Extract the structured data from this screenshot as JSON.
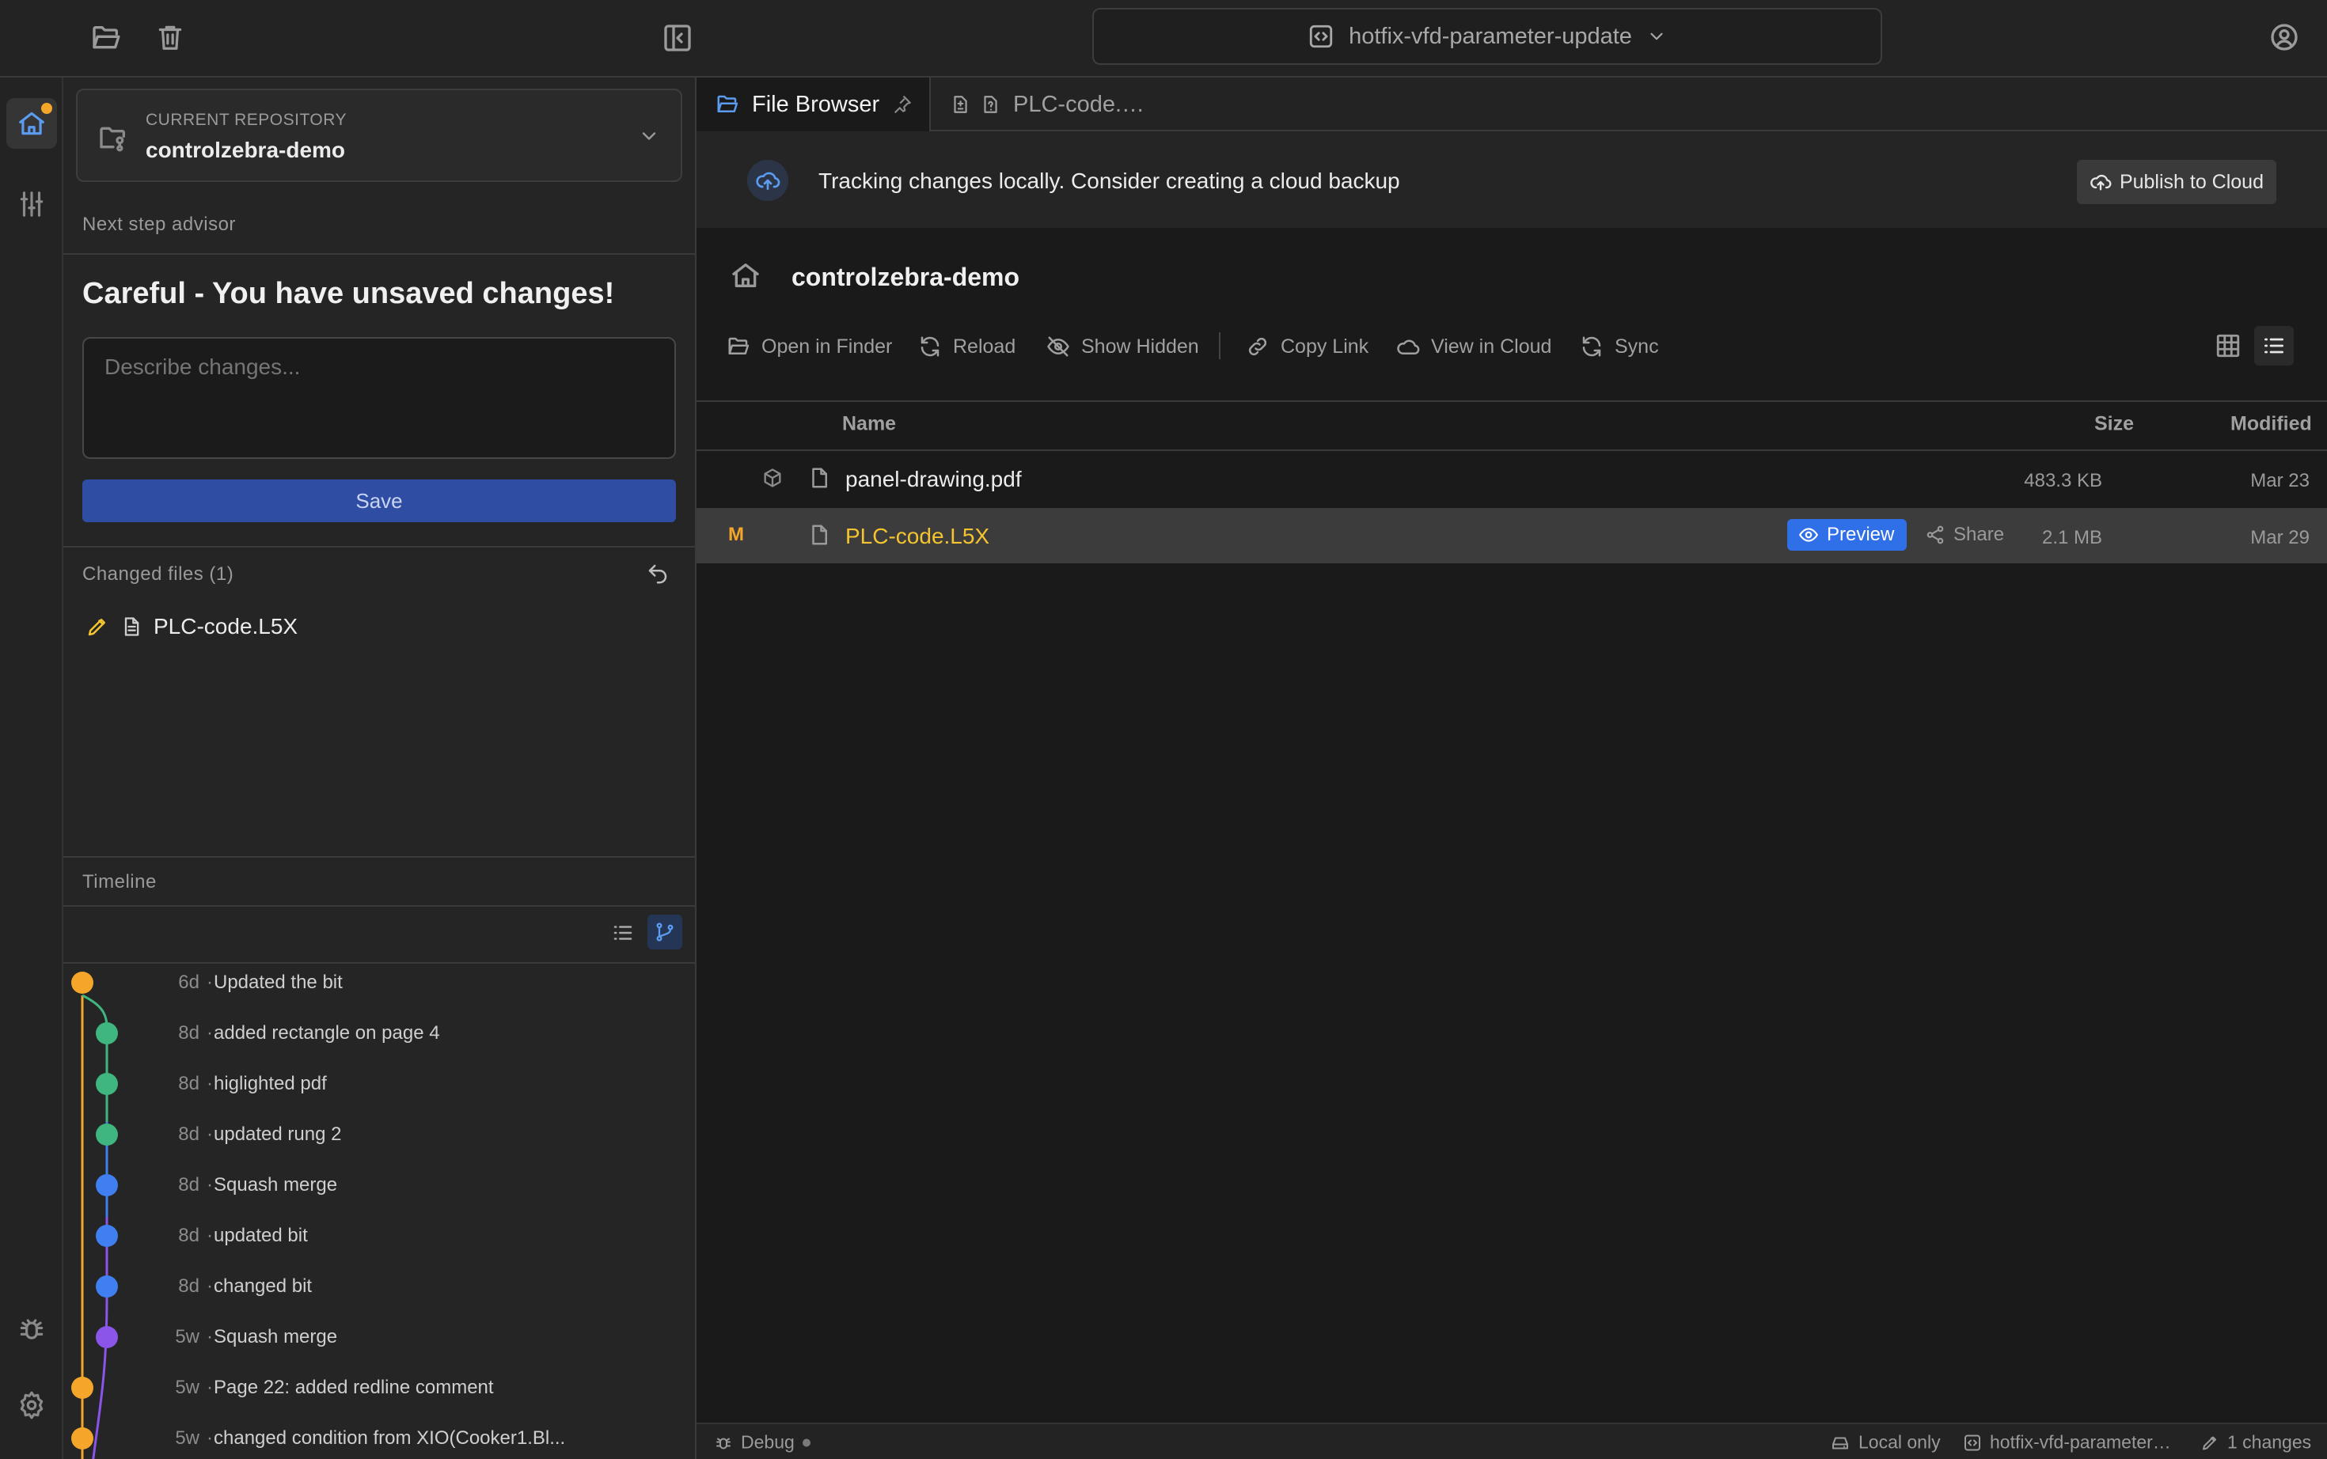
{
  "branch": {
    "name": "hotfix-vfd-parameter-update"
  },
  "repository": {
    "label": "CURRENT REPOSITORY",
    "name": "controlzebra-demo"
  },
  "advisor": {
    "label": "Next step advisor",
    "headline": "Careful - You have unsaved changes!",
    "placeholder": "Describe changes...",
    "save_label": "Save"
  },
  "changed_files": {
    "label": "Changed files (1)",
    "items": [
      {
        "name": "PLC-code.L5X",
        "status": "modified"
      }
    ]
  },
  "timeline": {
    "label": "Timeline",
    "commits": [
      {
        "age": "6d",
        "message": "Updated the bit",
        "color": "#f4a62a"
      },
      {
        "age": "8d",
        "message": "added rectangle on page 4",
        "color": "#3fb67f"
      },
      {
        "age": "8d",
        "message": "higlighted pdf",
        "color": "#3fb67f"
      },
      {
        "age": "8d",
        "message": "updated rung 2",
        "color": "#3fb67f"
      },
      {
        "age": "8d",
        "message": "Squash merge",
        "color": "#3f7ff0"
      },
      {
        "age": "8d",
        "message": "updated bit",
        "color": "#3f7ff0"
      },
      {
        "age": "8d",
        "message": "changed bit",
        "color": "#3f7ff0"
      },
      {
        "age": "5w",
        "message": "Squash merge",
        "color": "#8a55e8"
      },
      {
        "age": "5w",
        "message": "Page 22: added redline comment",
        "color": "#f4a62a"
      },
      {
        "age": "5w",
        "message": "changed condition from XIO(Cooker1.Bl...",
        "color": "#f4a62a"
      }
    ]
  },
  "tabs": [
    {
      "label": "File Browser",
      "active": true
    },
    {
      "label": "PLC-code.…",
      "active": false
    }
  ],
  "banner": {
    "text": "Tracking changes locally. Consider creating a cloud backup",
    "button": "Publish to Cloud"
  },
  "folder": {
    "title": "controlzebra-demo"
  },
  "toolbar": {
    "open_in_finder": "Open in Finder",
    "reload": "Reload",
    "show_hidden": "Show Hidden",
    "copy_link": "Copy Link",
    "view_in_cloud": "View in Cloud",
    "sync": "Sync"
  },
  "table": {
    "headers": {
      "name": "Name",
      "size": "Size",
      "modified": "Modified"
    },
    "rows": [
      {
        "name": "panel-drawing.pdf",
        "size": "483.3 KB",
        "modified": "Mar 23",
        "badge": "",
        "selected": false
      },
      {
        "name": "PLC-code.L5X",
        "size": "2.1 MB",
        "modified": "Mar 29",
        "badge": "M",
        "selected": true,
        "preview": "Preview",
        "share": "Share"
      }
    ]
  },
  "status": {
    "debug": "Debug",
    "location": "Local only",
    "branch": "hotfix-vfd-parameter…",
    "changes": "1 changes"
  },
  "colors": {
    "accent": "#2e4da3",
    "modified": "#f4a62a",
    "preview_badge": "#2f6fe8",
    "link_blue": "#5b9bf0"
  }
}
